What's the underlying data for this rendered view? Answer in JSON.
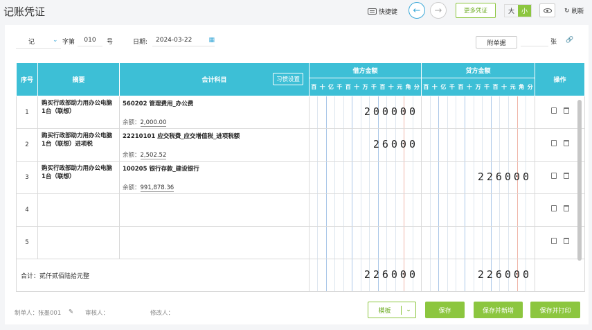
{
  "header": {
    "title": "记账凭证",
    "shortcut": "快捷键",
    "more": "更多凭证",
    "size_large": "大",
    "size_small": "小",
    "refresh": "刷新"
  },
  "voucher": {
    "type": "记",
    "word_label": "字第",
    "number": "010",
    "number_suffix": "号",
    "date_label": "日期:",
    "date": "2024-03-22",
    "attach_button": "附单据",
    "attach_unit": "张"
  },
  "table": {
    "col_seq": "序号",
    "col_summary": "摘要",
    "col_account": "会计科目",
    "habit_button": "习惯设置",
    "col_debit": "借方金额",
    "col_credit": "贷方金额",
    "col_ops": "操作",
    "units": [
      "百",
      "十",
      "亿",
      "千",
      "百",
      "十",
      "万",
      "千",
      "百",
      "十",
      "元",
      "角",
      "分"
    ],
    "rows": [
      {
        "seq": "1",
        "summary": "购买行政部助力用办公电脑1台（联想）",
        "account": "560202 管理费用_办公费",
        "balance_label": "余额：",
        "balance": "2,000.00",
        "debit": "200000",
        "credit": ""
      },
      {
        "seq": "2",
        "summary": "购买行政部助力用办公电脑1台（联想）进项税",
        "account": "22210101 应交税费_应交增值税_进项税额",
        "balance_label": "余额：",
        "balance": "2,502.52",
        "debit": "26000",
        "credit": ""
      },
      {
        "seq": "3",
        "summary": "购买行政部助力用办公电脑1台（联想）",
        "account": "100205 银行存款_建设银行",
        "balance_label": "余额：",
        "balance": "991,878.36",
        "debit": "",
        "credit": "226000"
      },
      {
        "seq": "4",
        "summary": "",
        "account": "",
        "balance_label": "",
        "balance": "",
        "debit": "",
        "credit": ""
      },
      {
        "seq": "5",
        "summary": "",
        "account": "",
        "balance_label": "",
        "balance": "",
        "debit": "",
        "credit": ""
      }
    ],
    "total_label": "合计：贰仟贰佰陆拾元整",
    "total_debit": "226000",
    "total_credit": "226000"
  },
  "footer": {
    "maker": "制单人：张墨001",
    "auditor": "审核人：",
    "modifier": "修改人：",
    "template": "模板",
    "save": "保存",
    "save_new": "保存并新增",
    "save_print": "保存并打印"
  },
  "colors": {
    "accent": "#8cc63f",
    "table_header": "#3dbfd6"
  }
}
